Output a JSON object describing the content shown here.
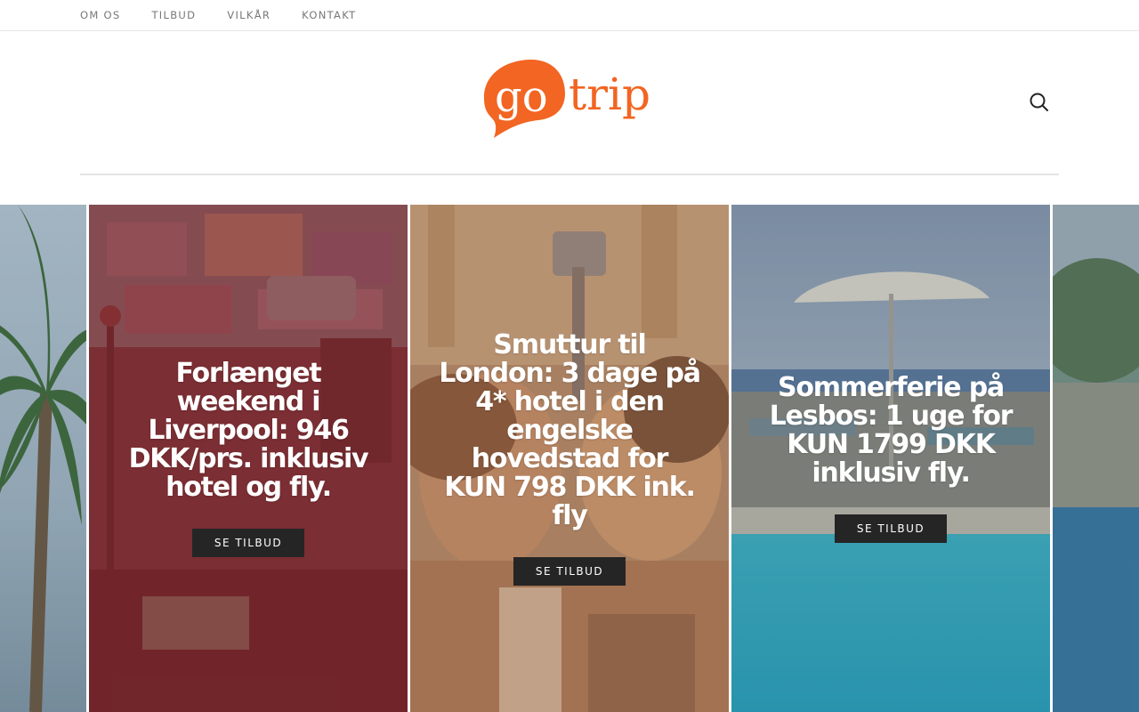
{
  "topnav": {
    "items": [
      {
        "label": "OM OS"
      },
      {
        "label": "TILBUD"
      },
      {
        "label": "VILKÅR"
      },
      {
        "label": "KONTAKT"
      }
    ]
  },
  "header": {
    "logo_text_go": "go",
    "logo_text_trip": "trip",
    "brand_color": "#f26522",
    "search_icon": "search-icon"
  },
  "slides": [
    {
      "title": "Forlænget weekend i Liverpool: 946 DKK/prs. inklusiv hotel og fly.",
      "button": "SE TILBUD"
    },
    {
      "title": "Smuttur til London: 3 dage på 4* hotel i den engelske hovedstad for KUN 798 DKK ink. fly",
      "button": "SE TILBUD"
    },
    {
      "title": "Sommerferie på Lesbos: 1 uge for KUN 1799 DKK inklusiv fly.",
      "button": "SE TILBUD"
    }
  ]
}
